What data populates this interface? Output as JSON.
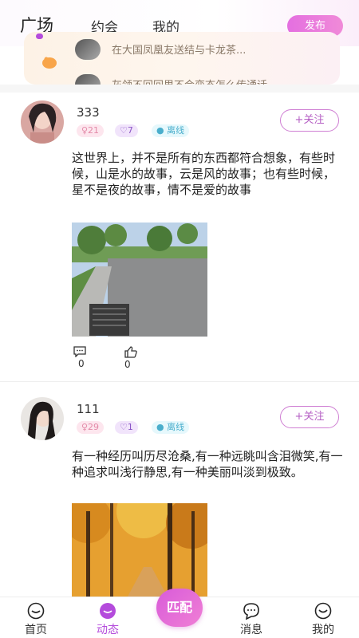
{
  "header": {
    "tabs": [
      "广场",
      "约会",
      "我的"
    ],
    "publish_label": "发布"
  },
  "notice": {
    "line1": "在大国凤凰友送结与卡龙茶...",
    "line2": "灰领不回回里不会变态怎么传通话"
  },
  "posts": [
    {
      "username": "333",
      "tag_female": "♀21",
      "tag_heart": "7",
      "tag_status": "离线",
      "follow_label": "+关注",
      "text": "这世界上，并不是所有的东西都符合想象，有些时候，山是水的故事，云是风的故事；也有些时候，星不是夜的故事，情不是爱的故事",
      "comments": "0",
      "likes": "0"
    },
    {
      "username": "111",
      "tag_female": "♀29",
      "tag_heart": "1",
      "tag_status": "离线",
      "follow_label": "+关注",
      "text": "有一种经历叫历尽沧桑,有一种远眺叫含泪微笑,有一种追求叫浅行静思,有一种美丽叫淡到极致。"
    }
  ],
  "bottom_nav": {
    "items": [
      "首页",
      "动态",
      "消息",
      "我的"
    ],
    "match_label": "匹配"
  },
  "colors": {
    "accent": "#b44bdc",
    "follow_border": "#cf7fd3"
  }
}
